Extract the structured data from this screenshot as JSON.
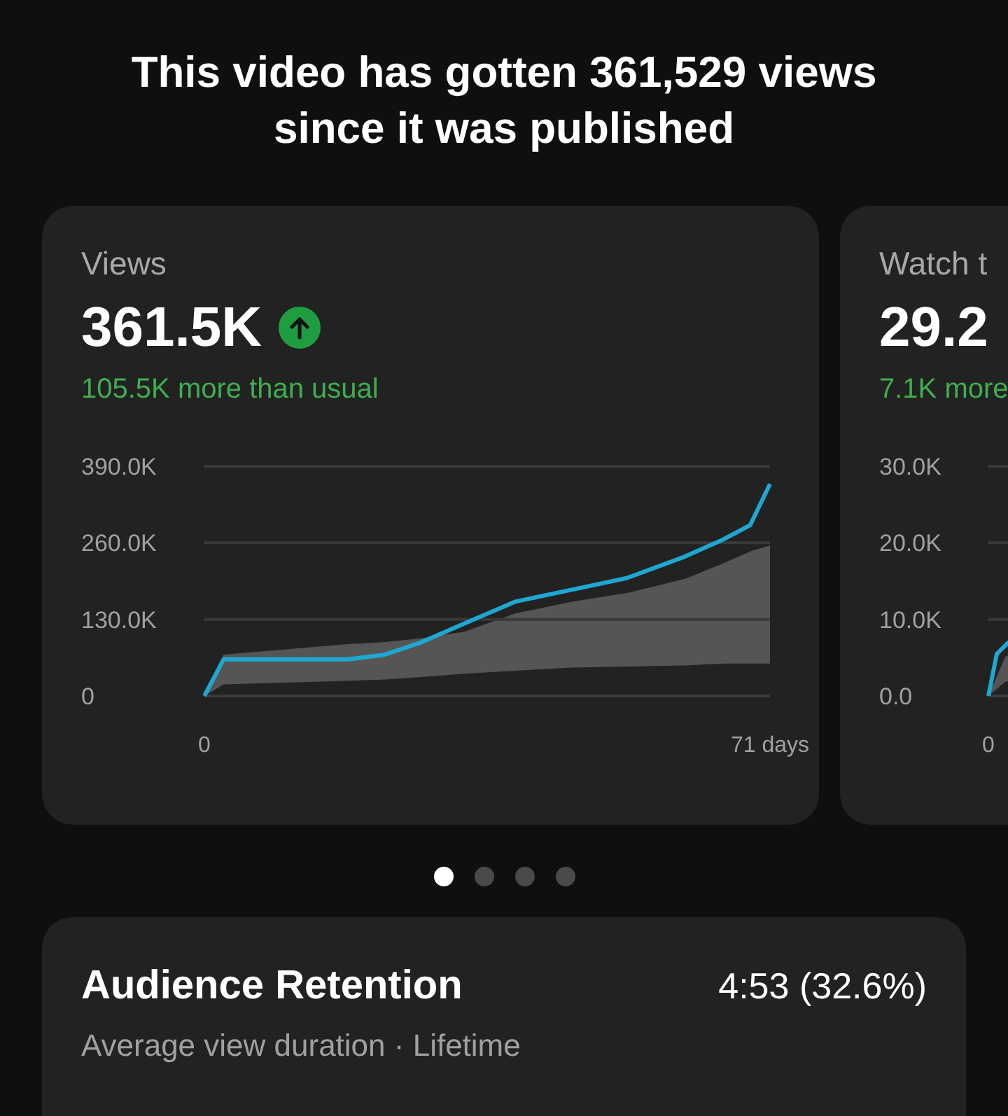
{
  "headline": "This video has gotten 361,529 views since it was published",
  "cards": [
    {
      "title": "Views",
      "value": "361.5K",
      "rising": true,
      "comparison": "105.5K more than usual",
      "chart_data": {
        "type": "line",
        "x": [
          0,
          2.4,
          18,
          22.6,
          27,
          33,
          39,
          46,
          53,
          60,
          65,
          68.5,
          71
        ],
        "xlim": [
          0,
          71
        ],
        "ylim": [
          0,
          390000
        ],
        "xticks": [
          {
            "value": 0,
            "label": "0"
          },
          {
            "value": 71,
            "label": "71 days"
          }
        ],
        "yticks": [
          {
            "value": 390000,
            "label": "390.0K"
          },
          {
            "value": 260000,
            "label": "260.0K"
          },
          {
            "value": 130000,
            "label": "130.0K"
          },
          {
            "value": 0,
            "label": "0"
          }
        ],
        "series": [
          {
            "color": "#1ea7d1",
            "values": [
              0,
              62000,
              62000,
              70000,
              90000,
              125000,
              160000,
              180000,
              200000,
              235000,
              265000,
              290000,
              360000
            ]
          }
        ]
      }
    },
    {
      "title": "Watch t",
      "value": "29.2",
      "comparison": "7.1K more",
      "chart_picture": {
        "y_labels": [
          "30.0K",
          "20.0K",
          "10.0K",
          "0.0"
        ],
        "x_label": "0"
      }
    }
  ],
  "pager": [
    {
      "selected": true
    },
    {
      "selected": false
    },
    {
      "selected": false
    },
    {
      "selected": false
    }
  ],
  "retention": {
    "title": "Audience Retention",
    "value": "4:53 (32.6%)",
    "subtitle": "Average view duration · Lifetime"
  }
}
